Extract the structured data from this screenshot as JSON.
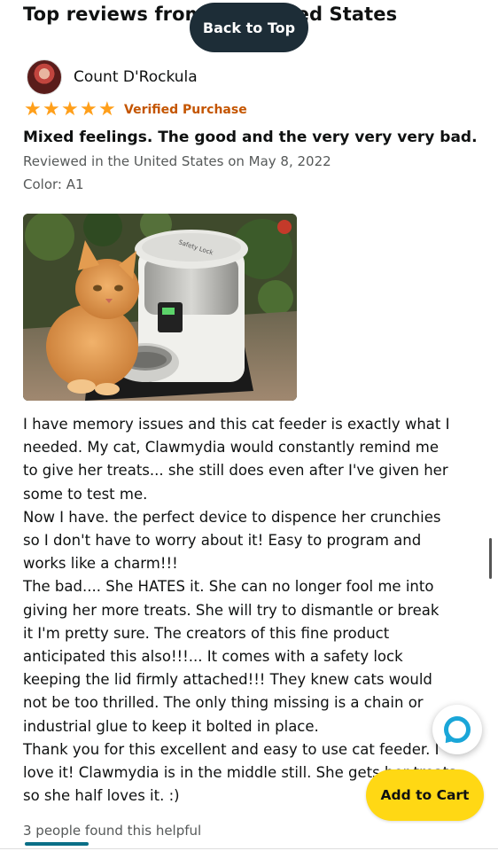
{
  "header": {
    "section_title": "Top reviews from the United States",
    "back_to_top_label": "Back to Top"
  },
  "review": {
    "reviewer_name": "Count D'Rockula",
    "rating": 5,
    "max_rating": 5,
    "verified_label": "Verified Purchase",
    "title": "Mixed feelings. The good and the very very very bad.",
    "date_line": "Reviewed in the United States on May 8, 2022",
    "variant_line": "Color: A1",
    "photo_label": "Safety Lock",
    "body_lines": [
      "I have memory issues and this cat feeder is exactly what I",
      "needed. My cat, Clawmydia would constantly remind me",
      "to give her treats... she still does even after I've given her",
      "some to test me.",
      "Now I have. the perfect device to dispence her crunchies",
      "so I don't have to worry about it! Easy to program and",
      "works like a charm!!!",
      "The bad.... She HATES it. She can no longer fool me into",
      "giving her more treats. She will try to dismantle or break",
      "it I'm pretty sure. The creators of this fine product",
      "anticipated this also!!!... It comes with a safety lock",
      "keeping the lid firmly attached!!! They knew cats would",
      "not be too thrilled. The only thing missing is a chain or",
      "industrial glue to keep it bolted in place.",
      "Thank you for this excellent and easy to use cat feeder. I",
      "love it! Clawmydia is in the middle still. She gets her treats",
      "so she half loves it. :)"
    ],
    "helpful_text": "3 people found this helpful"
  },
  "floating": {
    "add_to_cart_label": "Add to Cart",
    "assistant_icon": "alexa-icon"
  },
  "colors": {
    "star": "#ff9f1a",
    "verified": "#c45500",
    "back_to_top_bg": "#1d2d37",
    "add_to_cart_bg": "#ffd814",
    "alexa": "#1aa6d8"
  }
}
